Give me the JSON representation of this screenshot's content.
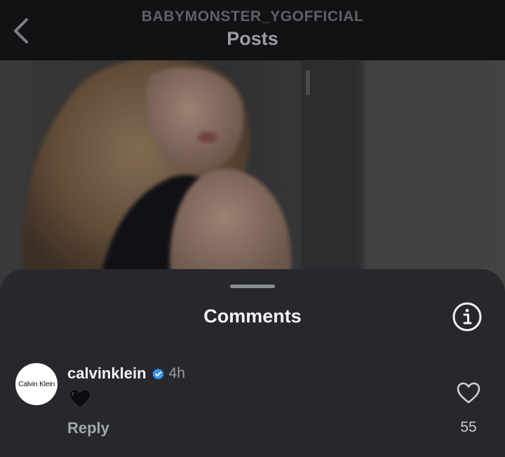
{
  "header": {
    "username": "BABYMONSTER_YGOFFICIAL",
    "title": "Posts",
    "back_icon": "chevron-left-icon"
  },
  "post": {
    "media_description_icon": "post-photo"
  },
  "comments_sheet": {
    "title": "Comments",
    "info_icon": "info-icon"
  },
  "comment": {
    "avatar_text": "Calvin Klein",
    "username": "calvinklein",
    "verified_icon": "verified-badge-icon",
    "timestamp": "4h",
    "body_icon": "black-heart-emoji",
    "reply_label": "Reply",
    "like_icon": "heart-outline-icon",
    "like_count": "55"
  },
  "colors": {
    "header_bg": "#111214",
    "sheet_bg": "#26282d",
    "verified_blue": "#3897f0",
    "text_primary": "#f2f3f5",
    "text_secondary": "#9a9da3"
  }
}
